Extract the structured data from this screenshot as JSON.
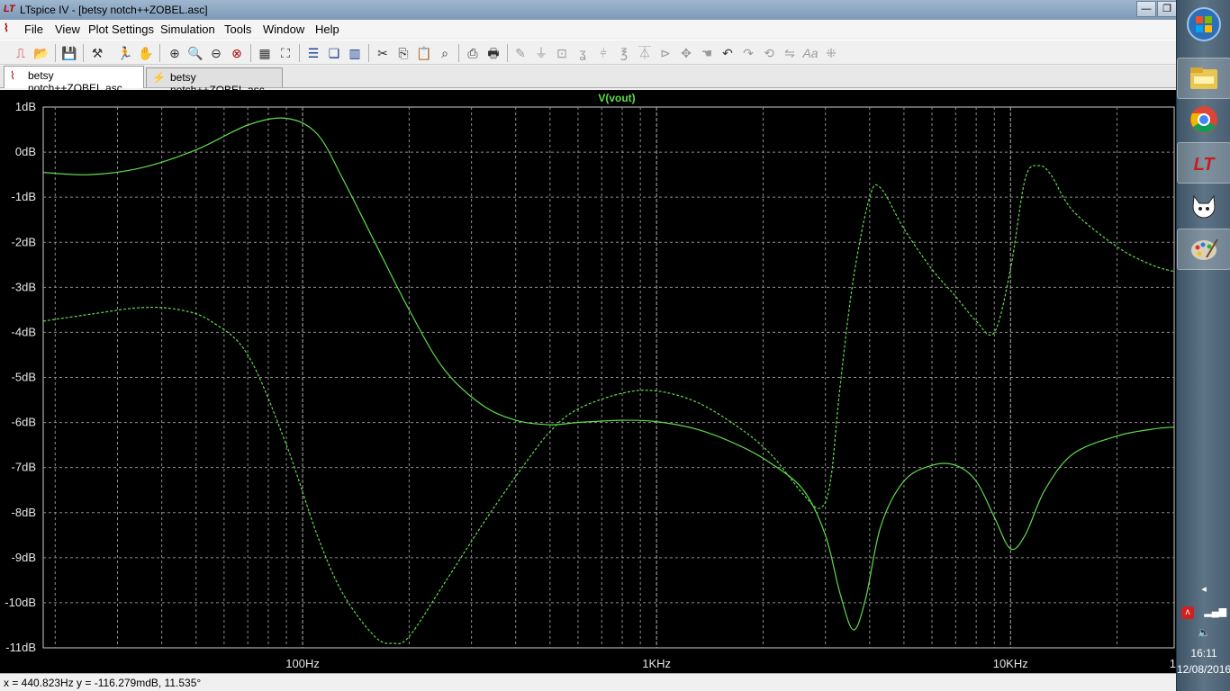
{
  "window": {
    "title": "LTspice IV - [betsy notch++ZOBEL.asc]",
    "app_icon_glyph": "LT",
    "min_glyph": "—",
    "max_glyph": "❐"
  },
  "menu": {
    "items": [
      "File",
      "View",
      "Plot Settings",
      "Simulation",
      "Tools",
      "Window",
      "Help"
    ]
  },
  "toolbar": {
    "buttons": [
      "new-schematic-icon",
      "open-icon",
      "save-icon",
      "control-panel-icon",
      "run-icon",
      "halt-icon",
      "zoom-in-icon",
      "zoom-rect-icon",
      "zoom-out-icon",
      "zoom-cancel-icon",
      "autorange-icon",
      "zoom-full-icon",
      "tile-horizontal-icon",
      "cascade-icon",
      "tile-vertical-icon",
      "cut-icon",
      "copy-icon",
      "paste-icon",
      "find-icon",
      "print-setup-icon",
      "print-icon",
      "wire-icon",
      "ground-icon",
      "label-icon",
      "resistor-icon",
      "capacitor-icon",
      "inductor-icon",
      "diode-icon",
      "component-icon",
      "move-icon",
      "drag-icon",
      "undo-icon",
      "redo-icon",
      "rotate-icon",
      "mirror-icon",
      "text-icon",
      "spice-directive-icon"
    ]
  },
  "tabs": [
    {
      "label": "betsy notch++ZOBEL.asc",
      "icon": "waveform-icon",
      "active": true
    },
    {
      "label": "betsy notch++ZOBEL.asc",
      "icon": "schematic-icon",
      "active": false
    }
  ],
  "plot": {
    "trace_name": "V(vout)",
    "trace_color": "#5edc4a",
    "background": "#000000",
    "grid_color": "#8c8c8c"
  },
  "chart_data": {
    "type": "line",
    "title": "V(vout)",
    "xscale": "log",
    "xlim": [
      18.5,
      29000
    ],
    "ylim": [
      -11,
      1
    ],
    "grid": true,
    "y_ticks": [
      "1dB",
      "0dB",
      "-1dB",
      "-2dB",
      "-3dB",
      "-4dB",
      "-5dB",
      "-6dB",
      "-7dB",
      "-8dB",
      "-9dB",
      "-10dB",
      "-11dB"
    ],
    "x_ticks": [
      "100Hz",
      "1KHz",
      "10KHz",
      "1"
    ],
    "series": [
      {
        "style": "solid",
        "x": [
          18.5,
          25,
          35,
          50,
          70,
          90,
          110,
          130,
          160,
          200,
          250,
          320,
          400,
          500,
          600,
          800,
          1000,
          1300,
          1700,
          2100,
          2600,
          3000,
          3300,
          3600,
          3900,
          4300,
          5000,
          6000,
          7000,
          8000,
          9000,
          10000,
          11000,
          12500,
          15000,
          20000,
          25000,
          29000
        ],
        "values": [
          -0.45,
          -0.5,
          -0.35,
          0.05,
          0.6,
          0.75,
          0.4,
          -0.6,
          -2.0,
          -3.5,
          -4.8,
          -5.6,
          -5.95,
          -6.05,
          -6.0,
          -5.95,
          -5.98,
          -6.15,
          -6.5,
          -6.9,
          -7.5,
          -8.5,
          -9.8,
          -10.6,
          -9.9,
          -8.3,
          -7.3,
          -6.95,
          -6.95,
          -7.3,
          -8.1,
          -8.8,
          -8.5,
          -7.5,
          -6.7,
          -6.3,
          -6.15,
          -6.1
        ]
      },
      {
        "style": "dashed",
        "x": [
          18.5,
          25,
          35,
          45,
          55,
          70,
          90,
          110,
          130,
          160,
          180,
          200,
          250,
          320,
          400,
          500,
          600,
          800,
          1000,
          1300,
          1700,
          2100,
          2600,
          2900,
          3100,
          3300,
          3600,
          4000,
          4300,
          5000,
          6000,
          7000,
          8000,
          9000,
          10000,
          11000,
          12000,
          13000,
          15000,
          20000,
          25000,
          29000
        ],
        "values": [
          -3.75,
          -3.6,
          -3.45,
          -3.5,
          -3.75,
          -4.5,
          -6.5,
          -8.5,
          -9.8,
          -10.75,
          -10.9,
          -10.75,
          -9.6,
          -8.3,
          -7.2,
          -6.2,
          -5.7,
          -5.35,
          -5.3,
          -5.55,
          -6.1,
          -6.7,
          -7.6,
          -7.9,
          -7.3,
          -5.2,
          -2.8,
          -1.0,
          -0.8,
          -1.7,
          -2.6,
          -3.2,
          -3.75,
          -4.0,
          -2.6,
          -0.6,
          -0.3,
          -0.5,
          -1.3,
          -2.1,
          -2.5,
          -2.65
        ]
      }
    ]
  },
  "status": {
    "text": "x = 440.823Hz    y = -116.279mdB, 11.535°"
  },
  "taskbar": {
    "apps": [
      "windows-start-icon",
      "file-explorer-icon",
      "chrome-icon",
      "ltspice-icon",
      "firefox-icon",
      "paint-icon"
    ],
    "tray_arrow": "◂",
    "time": "16:11",
    "date": "12/08/2016"
  }
}
